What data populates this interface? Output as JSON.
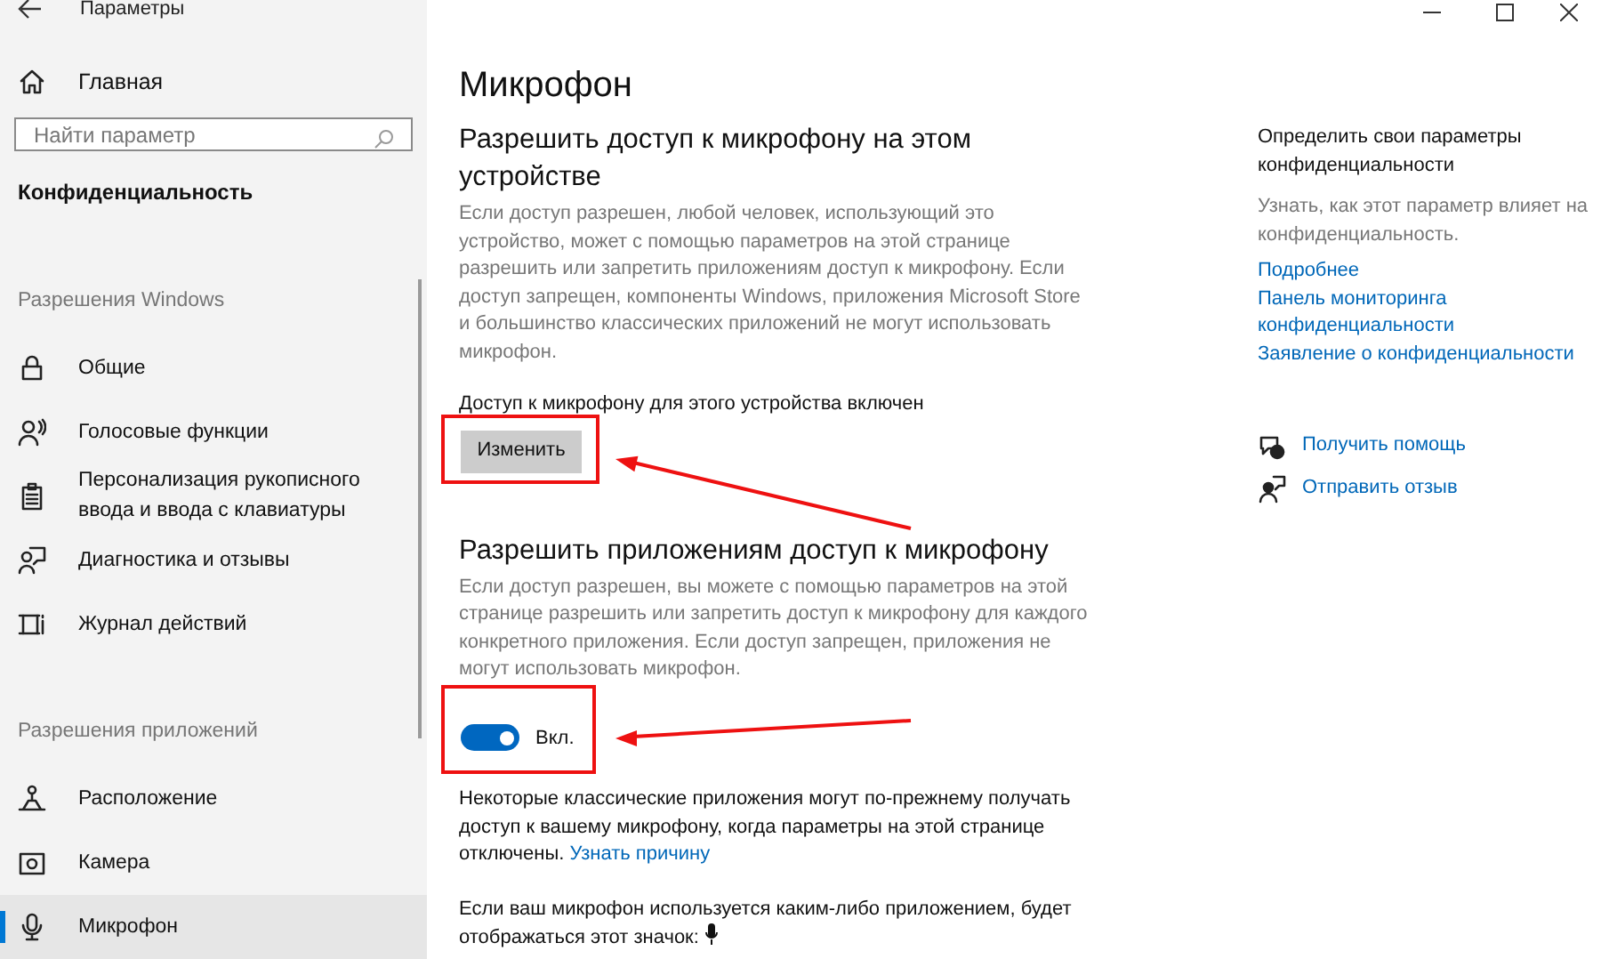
{
  "window": {
    "title": "Параметры"
  },
  "sidebar": {
    "home": "Главная",
    "search": {
      "placeholder": "Найти параметр"
    },
    "category": "Конфиденциальность",
    "items": [
      {
        "kind": "header",
        "label": "Разрешения Windows"
      },
      {
        "kind": "item",
        "label": "Общие",
        "selected": false
      },
      {
        "kind": "item",
        "label": "Голосовые функции",
        "selected": false
      },
      {
        "kind": "item",
        "label": "Персонализация рукописного ввода и ввода с клавиатуры",
        "selected": false
      },
      {
        "kind": "item",
        "label": "Диагностика и отзывы",
        "selected": false
      },
      {
        "kind": "item",
        "label": "Журнал действий",
        "selected": false
      },
      {
        "kind": "header",
        "label": "Разрешения приложений"
      },
      {
        "kind": "item",
        "label": "Расположение",
        "selected": false
      },
      {
        "kind": "item",
        "label": "Камера",
        "selected": false
      },
      {
        "kind": "item",
        "label": "Микрофон",
        "selected": true
      }
    ]
  },
  "page": {
    "title": "Микрофон",
    "device_section": {
      "heading": "Разрешить доступ к микрофону на этом устройстве",
      "description": "Если доступ разрешен, любой человек, использующий это устройство, может с помощью параметров на этой странице разрешить или запретить приложениям доступ к микрофону. Если доступ запрещен, компоненты Windows, приложения Microsoft Store и большинство классических приложений не могут использовать микрофон.",
      "status": "Доступ к микрофону для этого устройства включен",
      "button": "Изменить"
    },
    "apps_section": {
      "heading": "Разрешить приложениям доступ к микрофону",
      "description": "Если доступ разрешен, вы можете с помощью параметров на этой странице разрешить или запретить доступ к микрофону для каждого конкретного приложения. Если доступ запрещен, приложения не могут использовать микрофон.",
      "toggle": {
        "on": true,
        "label": "Вкл."
      },
      "note": "Некоторые классические приложения могут по-прежнему получать доступ к вашему микрофону, когда параметры на этой странице отключены.",
      "note_link": "Узнать причину",
      "indicator_note": "Если ваш микрофон используется каким-либо приложением, будет отображаться этот значок:"
    }
  },
  "aside": {
    "heading": "Определить свои параметры конфиденциальности",
    "description": "Узнать, как этот параметр влияет на конфиденциальность.",
    "links": [
      "Подробнее",
      "Панель мониторинга конфиденциальности",
      "Заявление о конфиденциальности"
    ],
    "actions": [
      "Получить помощь",
      "Отправить отзыв"
    ]
  }
}
